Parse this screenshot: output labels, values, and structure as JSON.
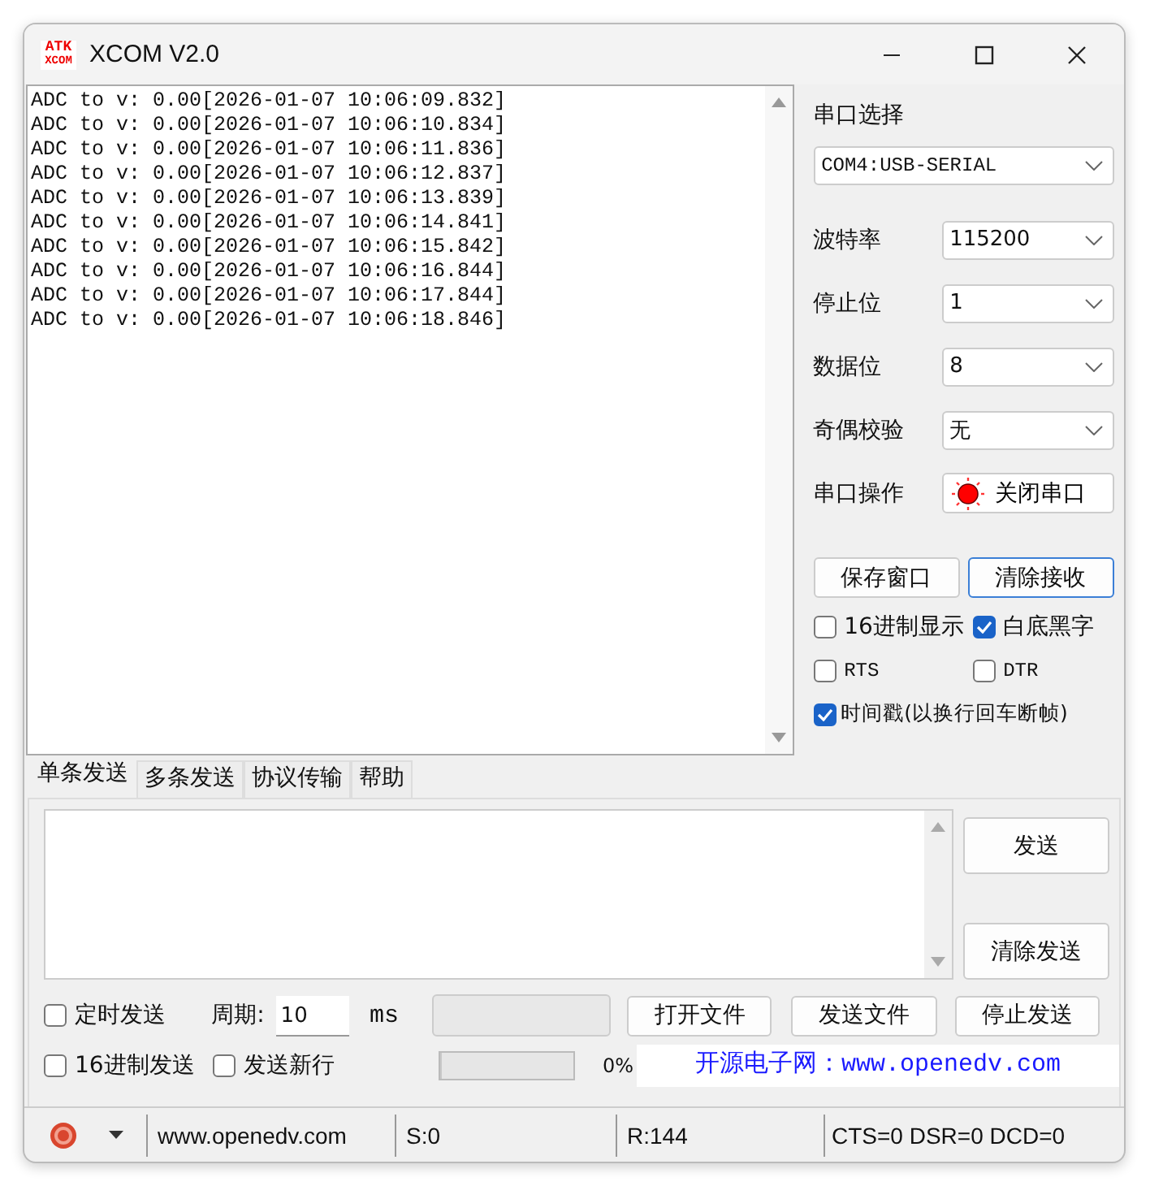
{
  "window": {
    "title": "XCOM V2.0",
    "logo_top": "ATK",
    "logo_bottom": "XCOM"
  },
  "receive_log": [
    "ADC to v: 0.00[2026-01-07 10:06:09.832]",
    "ADC to v: 0.00[2026-01-07 10:06:10.834]",
    "ADC to v: 0.00[2026-01-07 10:06:11.836]",
    "ADC to v: 0.00[2026-01-07 10:06:12.837]",
    "ADC to v: 0.00[2026-01-07 10:06:13.839]",
    "ADC to v: 0.00[2026-01-07 10:06:14.841]",
    "ADC to v: 0.00[2026-01-07 10:06:15.842]",
    "ADC to v: 0.00[2026-01-07 10:06:16.844]",
    "ADC to v: 0.00[2026-01-07 10:06:17.844]",
    "ADC to v: 0.00[2026-01-07 10:06:18.846]"
  ],
  "serial": {
    "port_label": "串口选择",
    "port_value": "COM4:USB-SERIAL",
    "fields": [
      {
        "label": "波特率",
        "value": "115200"
      },
      {
        "label": "停止位",
        "value": "1"
      },
      {
        "label": "数据位",
        "value": "8"
      },
      {
        "label": "奇偶校验",
        "value": "无"
      }
    ],
    "operation_label": "串口操作",
    "operation_button": "关闭串口",
    "port_open": true
  },
  "receive_buttons": [
    {
      "label": "保存窗口",
      "focused": false
    },
    {
      "label": "清除接收",
      "focused": true
    }
  ],
  "options": [
    [
      {
        "label": "16进制显示",
        "checked": false
      },
      {
        "label": "白底黑字",
        "checked": true
      }
    ],
    [
      {
        "label": "RTS",
        "checked": false
      },
      {
        "label": "DTR",
        "checked": false
      }
    ],
    [
      {
        "label": "时间戳(以换行回车断帧)",
        "checked": true
      }
    ]
  ],
  "send_tabs": [
    {
      "label": "单条发送",
      "selected": true
    },
    {
      "label": "多条发送",
      "selected": false
    },
    {
      "label": "协议传输",
      "selected": false
    },
    {
      "label": "帮助",
      "selected": false
    }
  ],
  "send_buttons": [
    "发送",
    "清除发送"
  ],
  "timed_send": {
    "label": "定时发送",
    "checked": false
  },
  "period": {
    "label": "周期:",
    "value": "10",
    "unit": "ms"
  },
  "hex_send": {
    "label": "16进制发送",
    "checked": false
  },
  "send_newline": {
    "label": "发送新行",
    "checked": false
  },
  "progress": {
    "level": 0,
    "reading": "0%"
  },
  "file_buttons": [
    "打开文件",
    "发送文件",
    "停止发送"
  ],
  "banner": "开源电子网：www.openedv.com",
  "status_bar": {
    "url": "www.openedv.com",
    "sent": "S:0",
    "received": "R:144",
    "lines": "CTS=0 DSR=0 DCD=0"
  }
}
